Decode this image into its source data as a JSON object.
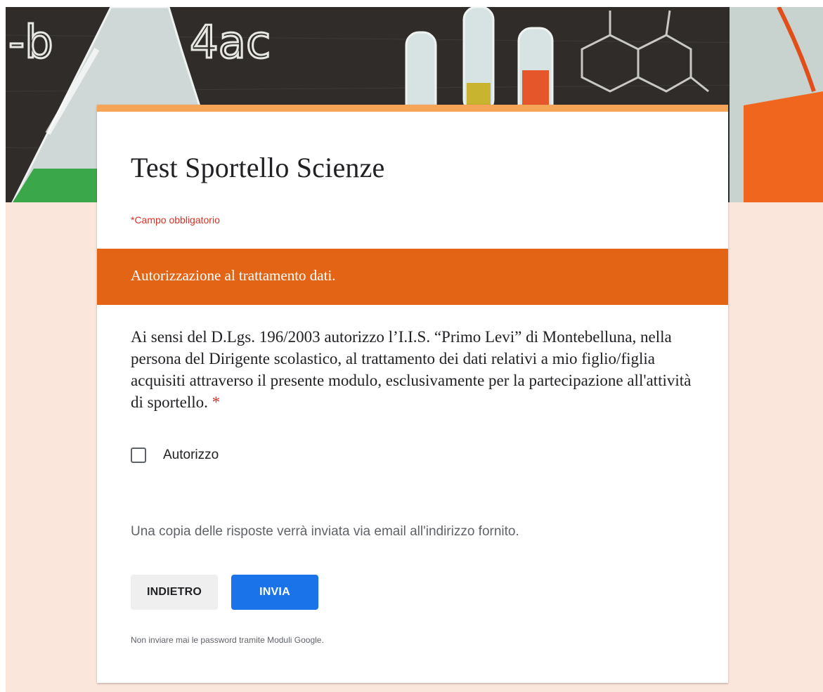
{
  "form": {
    "title": "Test Sportello Scienze",
    "required_note": "*Campo obbligatorio",
    "section_title": "Autorizzazione al trattamento dati.",
    "question": {
      "text": "Ai sensi del D.Lgs. 196/2003 autorizzo l’I.I.S. “Primo Levi” di Montebelluna, nella persona del Dirigente scolastico, al trattamento dei dati relativi a mio figlio/figlia acquisiti attraverso il presente modulo, esclusivamente per la partecipazione all'attività di sportello.",
      "required_marker": "*",
      "option_label": "Autorizzo",
      "checked": false
    },
    "email_note": "Una copia delle risposte verrà inviata via email all'indirizzo fornito.",
    "buttons": {
      "back": "INDIETRO",
      "submit": "INVIA"
    },
    "password_note": "Non inviare mai le password tramite Moduli Google."
  },
  "banner": {
    "chalk_text_left": "-b",
    "chalk_text_mid": "4ac"
  },
  "colors": {
    "page_background": "#fbe6dc",
    "accent_top": "#f6a458",
    "section_header": "#e26414",
    "required": "#d93025",
    "submit_button": "#1a73e8",
    "back_button": "#efefef"
  }
}
